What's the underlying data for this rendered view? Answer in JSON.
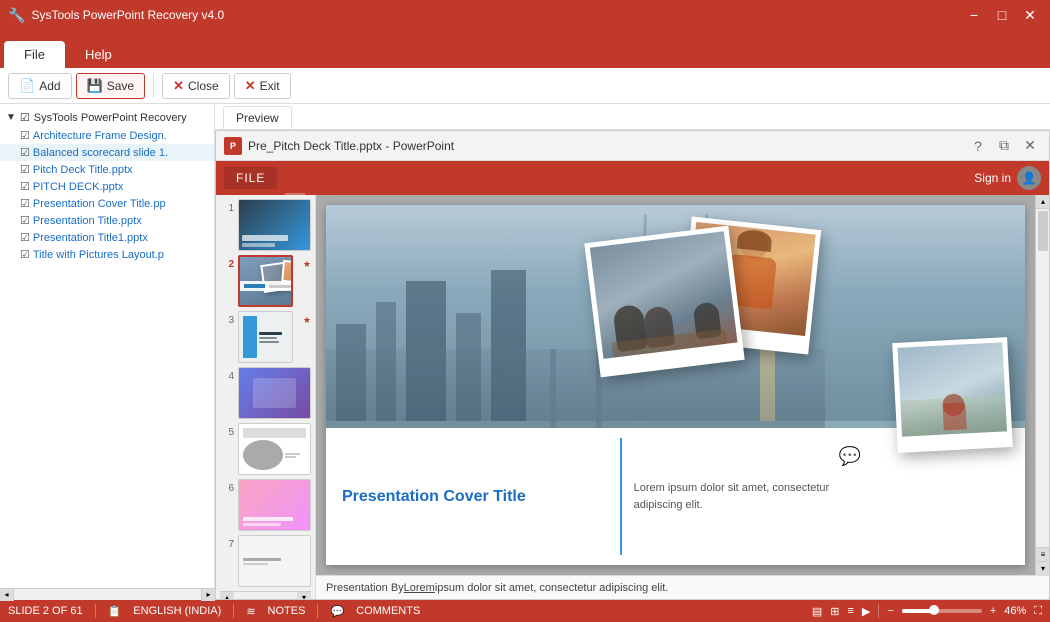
{
  "titlebar": {
    "title": "SysTools PowerPoint Recovery v4.0",
    "controls": {
      "minimize": "−",
      "maximize": "□",
      "close": "✕"
    }
  },
  "menubar": {
    "tabs": [
      {
        "id": "file",
        "label": "File",
        "active": true
      },
      {
        "id": "help",
        "label": "Help",
        "active": false
      }
    ]
  },
  "toolbar": {
    "add_label": "Add",
    "save_label": "Save",
    "close_label": "Close",
    "exit_label": "Exit"
  },
  "filetree": {
    "root_label": "SysTools PowerPoint Recovery",
    "items": [
      {
        "id": 1,
        "label": "Architecture Frame Design."
      },
      {
        "id": 2,
        "label": "Balanced scorecard slide 1."
      },
      {
        "id": 3,
        "label": "Pitch Deck Title.pptx"
      },
      {
        "id": 4,
        "label": "PITCH DECK.pptx"
      },
      {
        "id": 5,
        "label": "Presentation Cover Title.pp"
      },
      {
        "id": 6,
        "label": "Presentation Title.pptx"
      },
      {
        "id": 7,
        "label": "Presentation Title1.pptx"
      },
      {
        "id": 8,
        "label": "Title with Pictures Layout.p"
      }
    ]
  },
  "preview": {
    "tab_label": "Preview"
  },
  "ppt_window": {
    "title": "Pre_Pitch Deck Title.pptx - PowerPoint",
    "file_btn": "FILE",
    "sign_in": "Sign in",
    "help_icon": "?",
    "controls": {
      "restore": "⧉",
      "close": "✕"
    }
  },
  "slides": [
    {
      "num": "1",
      "star": ""
    },
    {
      "num": "2",
      "star": "*"
    },
    {
      "num": "3",
      "star": "*"
    },
    {
      "num": "4",
      "star": ""
    },
    {
      "num": "5",
      "star": ""
    },
    {
      "num": "6",
      "star": ""
    },
    {
      "num": "7",
      "star": ""
    }
  ],
  "slide_content": {
    "title": "Presentation Cover Title",
    "description": "Lorem ipsum dolor sit amet, consectetur adipiscing elit.",
    "footer_text": "Presentation By Lorem ipsum dolor sit amet, consectetur adipiscing elit.",
    "footer_underline": "Lorem"
  },
  "statusbar": {
    "slide_info": "SLIDE 2 OF 61",
    "language": "ENGLISH (INDIA)",
    "notes": "NOTES",
    "comments": "COMMENTS",
    "zoom_percent": "46%"
  }
}
